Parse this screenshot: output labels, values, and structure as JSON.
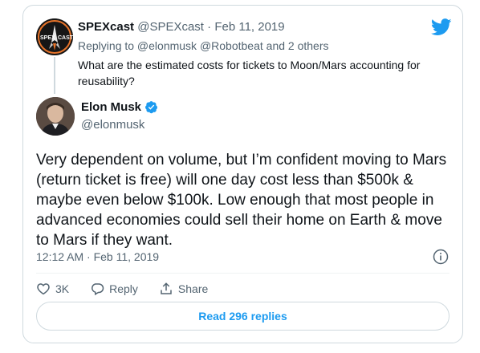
{
  "reply_to": {
    "display_name": "SPEXcast",
    "handle": "@SPEXcast",
    "separator": "·",
    "date": "Feb 11, 2019",
    "replying_to": "Replying to @elonmusk @Robotbeat and 2 others",
    "text": "What are the estimated costs for tickets to Moon/Mars accounting for reusability?",
    "avatar_text": "SPEX CAST"
  },
  "tweet": {
    "display_name": "Elon Musk",
    "handle": "@elonmusk",
    "text": "Very dependent on volume, but I’m confident moving to Mars (return ticket is free) will one day cost less than $500k & maybe even below $100k. Low enough that most people in advanced economies could sell their home on Earth & move to Mars if they want.",
    "timestamp": "12:12 AM · Feb 11, 2019"
  },
  "actions": {
    "like_count": "3K",
    "reply_label": "Reply",
    "share_label": "Share"
  },
  "read_replies_label": "Read 296 replies",
  "colors": {
    "brand": "#1d9bf0",
    "text": "#0f1419",
    "secondary": "#536471",
    "border": "#cfd9de"
  },
  "icons": [
    "twitter-bird-icon",
    "verified-badge-icon",
    "info-icon",
    "heart-icon",
    "reply-bubble-icon",
    "share-icon"
  ]
}
